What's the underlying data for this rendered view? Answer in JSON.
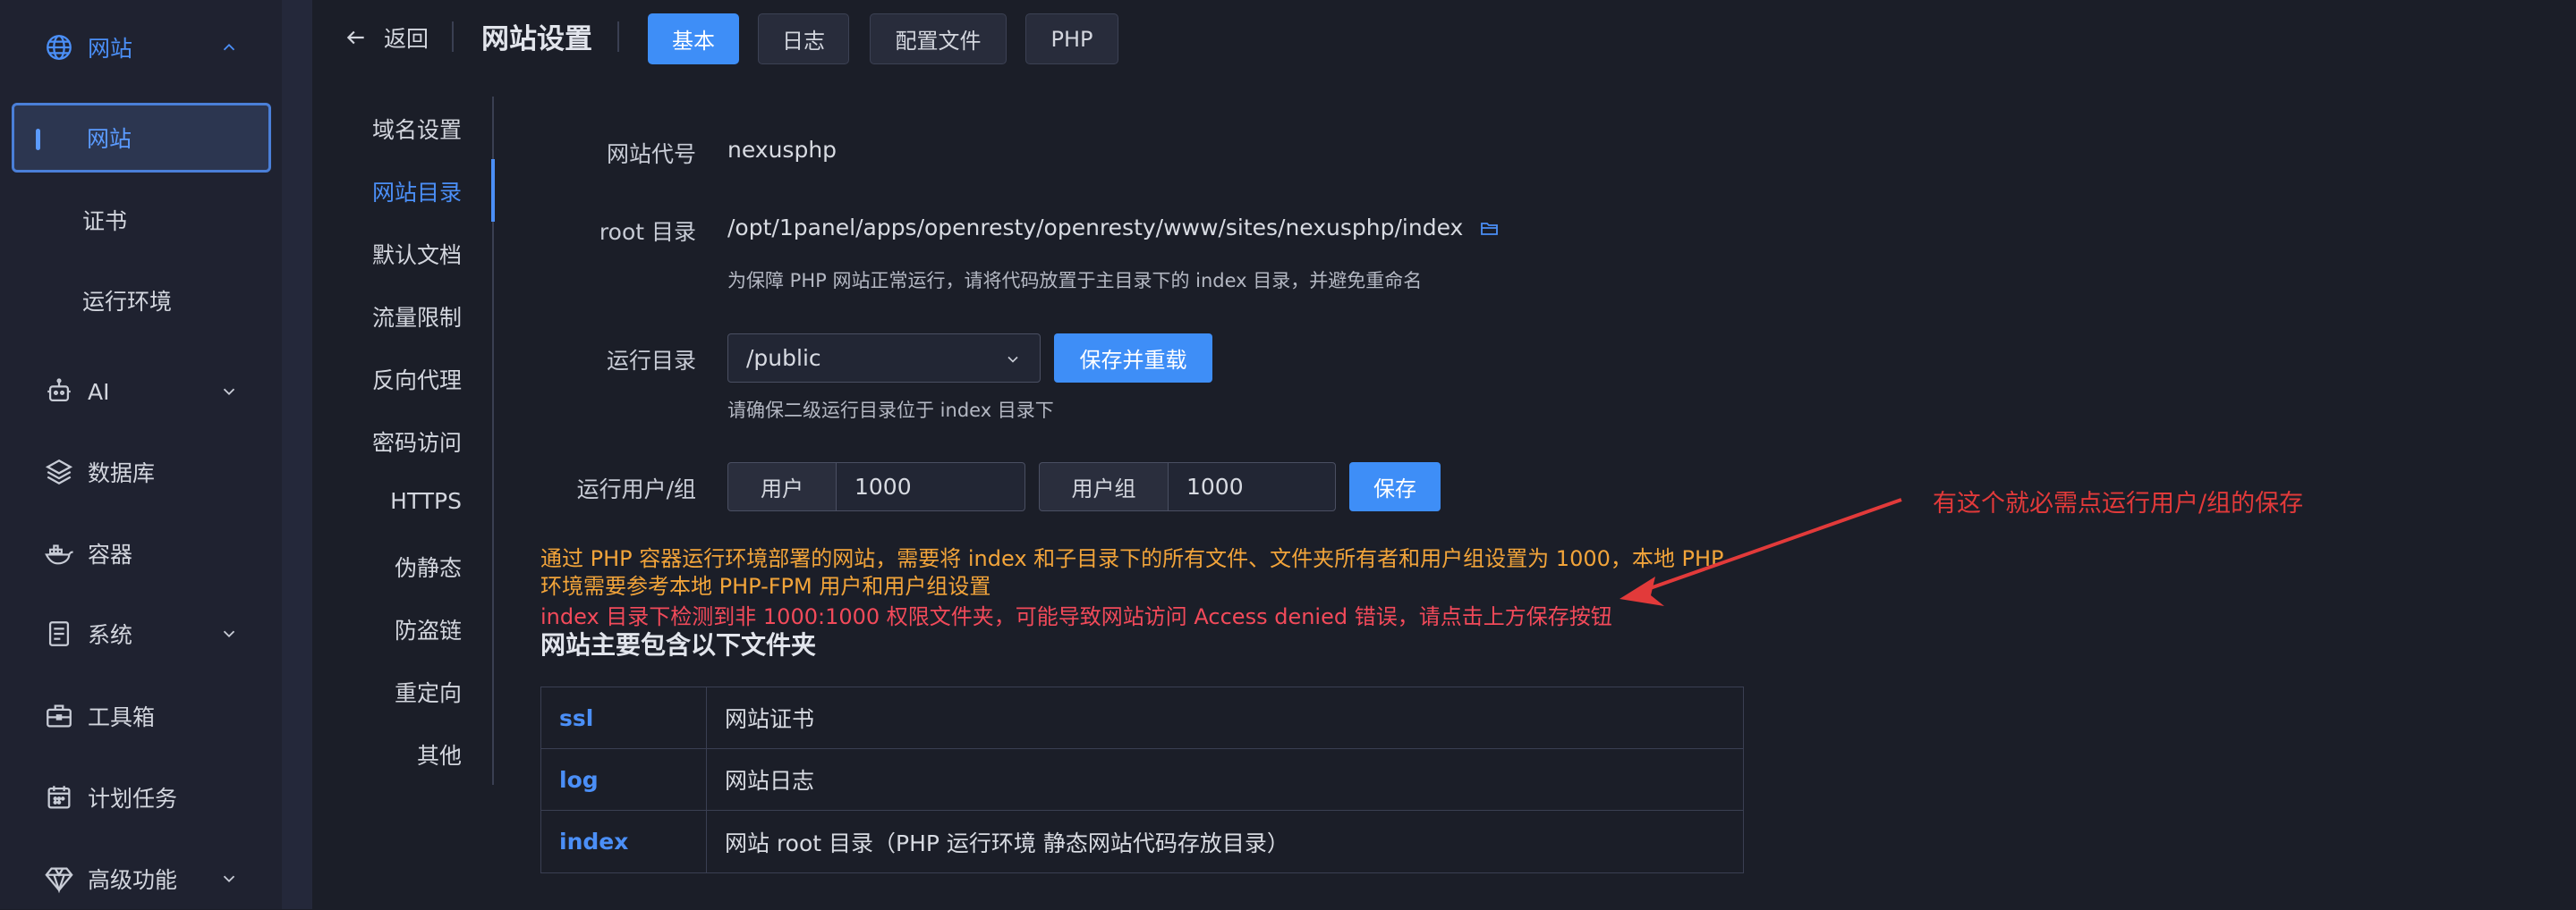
{
  "sidebar": {
    "group_website": "网站",
    "sub_website": "网站",
    "sub_cert": "证书",
    "sub_runtime": "运行环境",
    "ai": "AI",
    "database": "数据库",
    "container": "容器",
    "system": "系统",
    "toolbox": "工具箱",
    "cron": "计划任务",
    "advanced": "高级功能"
  },
  "header": {
    "back": "返回",
    "title": "网站设置",
    "tabs": [
      "基本",
      "日志",
      "配置文件",
      "PHP"
    ]
  },
  "nav": [
    "域名设置",
    "网站目录",
    "默认文档",
    "流量限制",
    "反向代理",
    "密码访问",
    "HTTPS",
    "伪静态",
    "防盗链",
    "重定向",
    "其他"
  ],
  "form": {
    "code_label": "网站代号",
    "code_value": "nexusphp",
    "root_label": "root 目录",
    "root_value": "/opt/1panel/apps/openresty/openresty/www/sites/nexusphp/index",
    "root_hint": "为保障 PHP 网站正常运行，请将代码放置于主目录下的 index 目录，并避免重命名",
    "run_dir_label": "运行目录",
    "run_dir_value": "/public",
    "save_reload": "保存并重载",
    "run_dir_hint": "请确保二级运行目录位于 index 目录下",
    "user_group_label": "运行用户/组",
    "user_addon": "用户",
    "user_value": "1000",
    "group_addon": "用户组",
    "group_value": "1000",
    "save": "保存",
    "warn_line1": "通过 PHP 容器运行环境部署的网站，需要将 index 和子目录下的所有文件、文件夹所有者和用户组设置为 1000，本地 PHP",
    "warn_line2": "环境需要参考本地 PHP-FPM 用户和用户组设置",
    "error_line": "index 目录下检测到非 1000:1000 权限文件夹，可能导致网站访问 Access denied 错误，请点击上方保存按钮"
  },
  "folders": {
    "title": "网站主要包含以下文件夹",
    "rows": [
      {
        "name": "ssl",
        "desc": "网站证书"
      },
      {
        "name": "log",
        "desc": "网站日志"
      },
      {
        "name": "index",
        "desc": "网站 root 目录（PHP 运行环境 静态网站代码存放目录）"
      }
    ]
  },
  "annotation": "有这个就必需点运行用户/组的保存",
  "colors": {
    "accent": "#3e8ef7",
    "warning": "#f2a43a",
    "error": "#f24a5a",
    "annotation": "#e23a3a"
  }
}
